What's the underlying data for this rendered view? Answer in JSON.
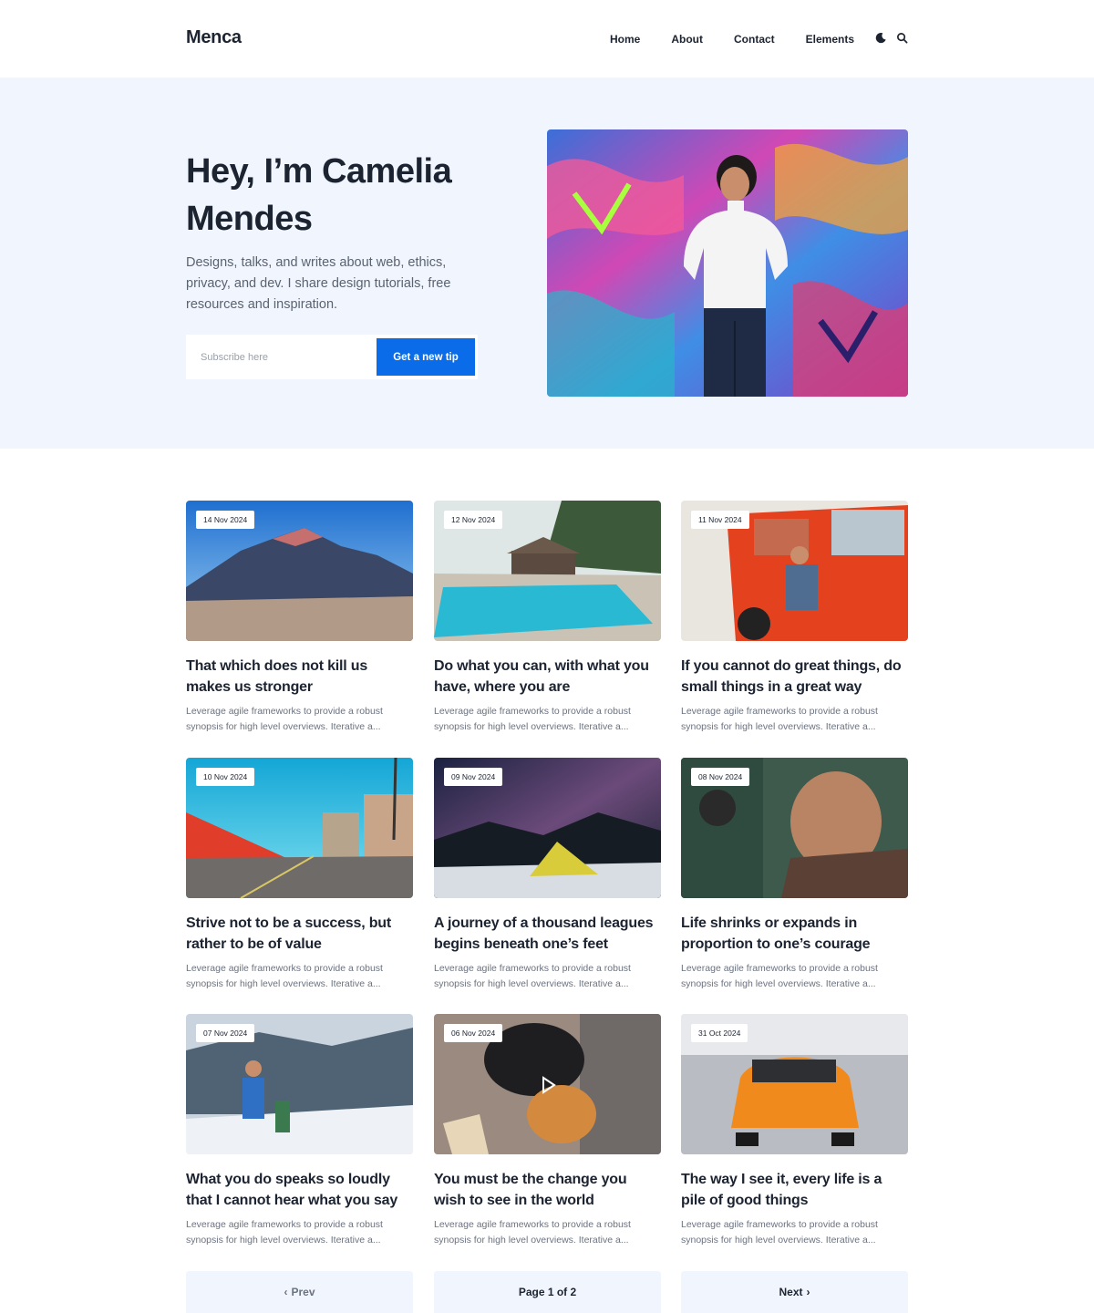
{
  "header": {
    "logo": "Menca",
    "nav": [
      "Home",
      "About",
      "Contact",
      "Elements"
    ],
    "icons": [
      "moon-icon",
      "search-icon"
    ]
  },
  "hero": {
    "title": "Hey, I’m Camelia Mendes",
    "description": "Designs, talks, and writes about web, ethics, privacy, and dev. I share design tutorials, free resources and inspiration.",
    "subscribe_placeholder": "Subscribe here",
    "button_label": "Get a new tip",
    "accent_color": "#0a6ce8"
  },
  "posts": [
    {
      "date": "14 Nov 2024",
      "title": "That which does not kill us makes us stronger",
      "excerpt": "Leverage agile frameworks to provide a robust synopsis for high level overviews. Iterative a..."
    },
    {
      "date": "12 Nov 2024",
      "title": "Do what you can, with what you have, where you are",
      "excerpt": "Leverage agile frameworks to provide a robust synopsis for high level overviews. Iterative a..."
    },
    {
      "date": "11 Nov 2024",
      "title": "If you cannot do great things, do small things in a great way",
      "excerpt": "Leverage agile frameworks to provide a robust synopsis for high level overviews. Iterative a..."
    },
    {
      "date": "10 Nov 2024",
      "title": "Strive not to be a success, but rather to be of value",
      "excerpt": "Leverage agile frameworks to provide a robust synopsis for high level overviews. Iterative a..."
    },
    {
      "date": "09 Nov 2024",
      "title": "A journey of a thousand leagues begins beneath one’s feet",
      "excerpt": "Leverage agile frameworks to provide a robust synopsis for high level overviews. Iterative a..."
    },
    {
      "date": "08 Nov 2024",
      "title": "Life shrinks or expands in proportion to one’s courage",
      "excerpt": "Leverage agile frameworks to provide a robust synopsis for high level overviews. Iterative a..."
    },
    {
      "date": "07 Nov 2024",
      "title": "What you do speaks so loudly that I cannot hear what you say",
      "excerpt": "Leverage agile frameworks to provide a robust synopsis for high level overviews. Iterative a..."
    },
    {
      "date": "06 Nov 2024",
      "title": "You must be the change you wish to see in the world",
      "excerpt": "Leverage agile frameworks to provide a robust synopsis for high level overviews. Iterative a..."
    },
    {
      "date": "31 Oct 2024",
      "title": "The way I see it, every life is a pile of good things",
      "excerpt": "Leverage agile frameworks to provide a robust synopsis for high level overviews. Iterative a..."
    }
  ],
  "pagination": {
    "prev": "Prev",
    "page": "Page 1 of 2",
    "next": "Next"
  }
}
